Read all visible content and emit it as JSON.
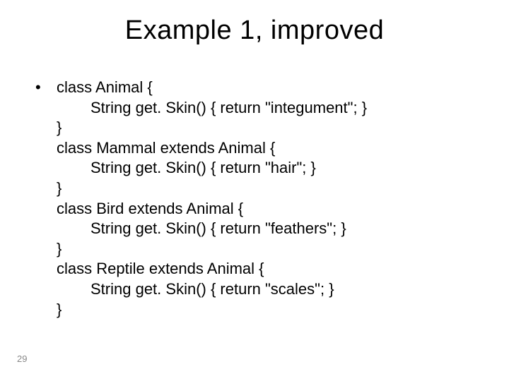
{
  "title": "Example 1, improved",
  "bullet_marker": "•",
  "code": {
    "l1": "class Animal {",
    "l2": "String get. Skin() { return \"integument\"; }",
    "l3": "}",
    "l4": "class Mammal extends Animal {",
    "l5": "String get. Skin() { return \"hair\"; }",
    "l6": "}",
    "l7": "class Bird extends Animal {",
    "l8": "String get. Skin() { return \"feathers\"; }",
    "l9": "}",
    "l10": "class Reptile extends Animal {",
    "l11": "String get. Skin() { return \"scales\"; }",
    "l12": "}"
  },
  "page_number": "29"
}
